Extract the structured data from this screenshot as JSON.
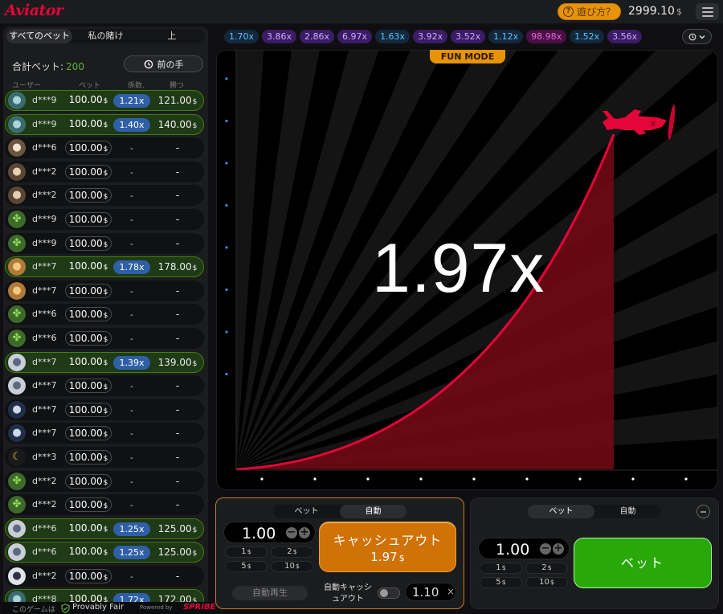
{
  "header": {
    "logo": "Aviator",
    "how_to_play": "遊び方？",
    "how_icon": "?",
    "balance_value": "2999.10",
    "balance_currency": "$",
    "menu_icon": "hamburger-menu-icon"
  },
  "bets_panel": {
    "tabs": [
      "すべてのベット",
      "私の賭け",
      "上"
    ],
    "total_label": "合計ベット:",
    "total_value": "200",
    "previous_label": "前の手",
    "columns": [
      "ユーザー",
      "ベット",
      "係数.",
      "勝つ"
    ],
    "currency": "$",
    "rows": [
      {
        "user": "d***9",
        "bet": "100.00",
        "coef": "1.21x",
        "cashout": "121.00",
        "win": true
      },
      {
        "user": "d***9",
        "bet": "100.00",
        "coef": "1.40x",
        "cashout": "140.00",
        "win": true
      },
      {
        "user": "d***6",
        "bet": "100.00",
        "coef": "-",
        "cashout": "-",
        "win": false
      },
      {
        "user": "d***2",
        "bet": "100.00",
        "coef": "-",
        "cashout": "-",
        "win": false
      },
      {
        "user": "d***2",
        "bet": "100.00",
        "coef": "-",
        "cashout": "-",
        "win": false
      },
      {
        "user": "d***9",
        "bet": "100.00",
        "coef": "-",
        "cashout": "-",
        "win": false
      },
      {
        "user": "d***9",
        "bet": "100.00",
        "coef": "-",
        "cashout": "-",
        "win": false
      },
      {
        "user": "d***7",
        "bet": "100.00",
        "coef": "1.78x",
        "cashout": "178.00",
        "win": true
      },
      {
        "user": "d***7",
        "bet": "100.00",
        "coef": "-",
        "cashout": "-",
        "win": false
      },
      {
        "user": "d***6",
        "bet": "100.00",
        "coef": "-",
        "cashout": "-",
        "win": false
      },
      {
        "user": "d***6",
        "bet": "100.00",
        "coef": "-",
        "cashout": "-",
        "win": false
      },
      {
        "user": "d***7",
        "bet": "100.00",
        "coef": "1.39x",
        "cashout": "139.00",
        "win": true
      },
      {
        "user": "d***7",
        "bet": "100.00",
        "coef": "-",
        "cashout": "-",
        "win": false
      },
      {
        "user": "d***7",
        "bet": "100.00",
        "coef": "-",
        "cashout": "-",
        "win": false
      },
      {
        "user": "d***7",
        "bet": "100.00",
        "coef": "-",
        "cashout": "-",
        "win": false
      },
      {
        "user": "d***3",
        "bet": "100.00",
        "coef": "-",
        "cashout": "-",
        "win": false
      },
      {
        "user": "d***2",
        "bet": "100.00",
        "coef": "-",
        "cashout": "-",
        "win": false
      },
      {
        "user": "d***2",
        "bet": "100.00",
        "coef": "-",
        "cashout": "-",
        "win": false
      },
      {
        "user": "d***6",
        "bet": "100.00",
        "coef": "1.25x",
        "cashout": "125.00",
        "win": true
      },
      {
        "user": "d***6",
        "bet": "100.00",
        "coef": "1.25x",
        "cashout": "125.00",
        "win": true
      },
      {
        "user": "d***2",
        "bet": "100.00",
        "coef": "-",
        "cashout": "-",
        "win": false
      },
      {
        "user": "d***8",
        "bet": "100.00",
        "coef": "1.72x",
        "cashout": "172.00",
        "win": true
      }
    ],
    "avatars": [
      "robot",
      "robot",
      "pirate",
      "monkey",
      "monkey",
      "clover",
      "clover",
      "lion",
      "lion",
      "clover",
      "clover",
      "car",
      "car",
      "alien",
      "alien",
      "moon",
      "clover",
      "clover",
      "car",
      "car",
      "astronaut",
      "robot"
    ]
  },
  "footer": {
    "game_prefix": "このゲームは",
    "provably_fair": "Provably Fair",
    "powered_by": "Powered by",
    "brand": "SPRIBE"
  },
  "history": {
    "items": [
      {
        "value": "1.70x",
        "color": "#34b4ff"
      },
      {
        "value": "3.86x",
        "color": "#913ef8"
      },
      {
        "value": "2.86x",
        "color": "#913ef8"
      },
      {
        "value": "6.97x",
        "color": "#913ef8"
      },
      {
        "value": "1.63x",
        "color": "#34b4ff"
      },
      {
        "value": "3.92x",
        "color": "#913ef8"
      },
      {
        "value": "3.52x",
        "color": "#913ef8"
      },
      {
        "value": "1.12x",
        "color": "#34b4ff"
      },
      {
        "value": "98.98x",
        "color": "#c017b4"
      },
      {
        "value": "1.52x",
        "color": "#34b4ff"
      },
      {
        "value": "3.56x",
        "color": "#913ef8"
      }
    ]
  },
  "game": {
    "mode_badge": "FUN MODE",
    "multiplier": "1.97x",
    "curve_color": "#e50539"
  },
  "bet_panel_1": {
    "tabs": [
      "ベット",
      "自動"
    ],
    "amount": "1.00",
    "quick": [
      "1",
      "2",
      "5",
      "10"
    ],
    "currency": "$",
    "cashout_label": "キャッシュアウト",
    "cashout_value": "1.97",
    "autoplay_label": "自動再生",
    "auto_cashout_label": "自動キャッシュアウト",
    "auto_cashout_value": "1.10",
    "auto_cashout_clear": "×"
  },
  "bet_panel_2": {
    "tabs": [
      "ベット",
      "自動"
    ],
    "amount": "1.00",
    "quick": [
      "1",
      "2",
      "5",
      "10"
    ],
    "currency": "$",
    "bet_label": "ベット"
  }
}
